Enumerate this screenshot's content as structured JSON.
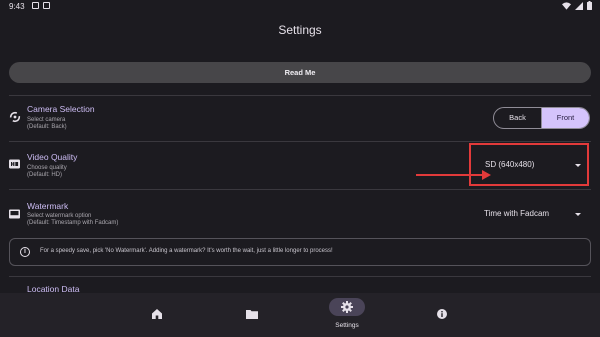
{
  "status_bar": {
    "time": "9:43"
  },
  "app_bar": {
    "title": "Settings"
  },
  "readme_button": {
    "label": "Read Me"
  },
  "settings": {
    "camera": {
      "title": "Camera Selection",
      "subtitle": "Select camera",
      "default": "(Default: Back)",
      "options": [
        "Back",
        "Front"
      ],
      "selected": "Front"
    },
    "video_quality": {
      "title": "Video Quality",
      "subtitle": "Choose quality",
      "default": "(Default: HD)",
      "value": "SD (640x480)",
      "icon": "hd-icon"
    },
    "watermark": {
      "title": "Watermark",
      "subtitle": "Select watermark option",
      "default": "(Default: Timestamp with Fadcam)",
      "value": "Time with Fadcam"
    },
    "info": {
      "text": "For a speedy save, pick 'No Watermark'. Adding a watermark? It's worth the wait, just a little longer to process!"
    },
    "location": {
      "title": "Location Data"
    }
  },
  "bottom_nav": {
    "items": [
      {
        "icon": "home-icon",
        "label": ""
      },
      {
        "icon": "folder-icon",
        "label": ""
      },
      {
        "icon": "gear-icon",
        "label": "Settings",
        "selected": true
      },
      {
        "icon": "info-icon",
        "label": ""
      }
    ]
  },
  "colors": {
    "background": "#1c1b20",
    "accent": "#d5c4fb",
    "title_text": "#cdbdf4",
    "annotation": "#e23a3a"
  }
}
